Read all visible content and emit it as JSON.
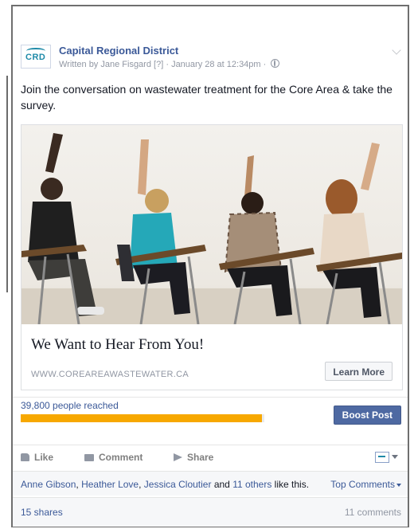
{
  "post": {
    "page_name": "Capital Regional District",
    "logo_text": "CRD",
    "byline": "Written by Jane Fisgard",
    "help_marker": "[?]",
    "timestamp": "January 28 at 12:34pm",
    "separator": "·",
    "text": "Join the conversation on wastewater treatment for the Core Area & take the survey.",
    "privacy_icon": "globe-icon"
  },
  "link_preview": {
    "title": "We Want to Hear From You!",
    "domain": "WWW.COREAREAWASTEWATER.CA",
    "cta_label": "Learn More"
  },
  "insights": {
    "reach_text": "39,800 people reached",
    "reach_fraction": 0.99,
    "reach_color": "#f7a800",
    "boost_label": "Boost Post"
  },
  "actions": {
    "like": "Like",
    "comment": "Comment",
    "share": "Share"
  },
  "social": {
    "liker_1": "Anne Gibson",
    "sep_1": ", ",
    "liker_2": "Heather Love",
    "sep_2": ", ",
    "liker_3": "Jessica Cloutier",
    "and_text": " and ",
    "others": "11 others",
    "like_suffix": " like this.",
    "top_comments": "Top Comments",
    "shares": "15 shares",
    "comments": "11 comments"
  },
  "colors": {
    "brand": "#3b5998",
    "boost": "#4e69a2"
  }
}
